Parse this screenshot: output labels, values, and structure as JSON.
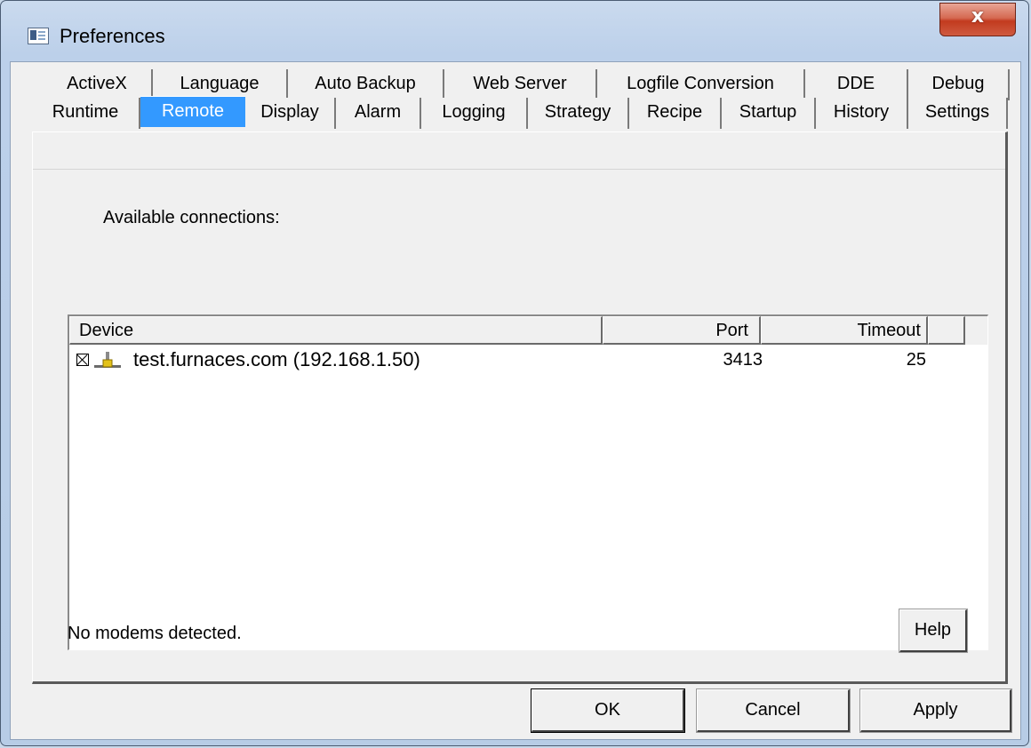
{
  "window": {
    "title": "Preferences",
    "close_glyph": "x"
  },
  "tabs_row1": [
    "ActiveX",
    "Language",
    "Auto Backup",
    "Web Server",
    "Logfile Conversion",
    "DDE",
    "Debug"
  ],
  "tabs_row2": [
    "Runtime",
    "Remote",
    "Display",
    "Alarm",
    "Logging",
    "Strategy",
    "Recipe",
    "Startup",
    "History",
    "Settings"
  ],
  "active_tab": "Remote",
  "panel": {
    "available_label": "Available connections:",
    "columns": {
      "device": "Device",
      "port": "Port",
      "timeout": "Timeout"
    },
    "connections": [
      {
        "device": "test.furnaces.com (192.168.1.50)",
        "port": "3413",
        "timeout": "25",
        "checked": true,
        "icon": "network-icon"
      }
    ],
    "status": "No modems detected.",
    "help_label": "Help"
  },
  "buttons": {
    "ok": "OK",
    "cancel": "Cancel",
    "apply": "Apply"
  },
  "colors": {
    "selected_tab": "#3399ff",
    "close_button": "#c7432a",
    "frame": "#b9cde6"
  }
}
